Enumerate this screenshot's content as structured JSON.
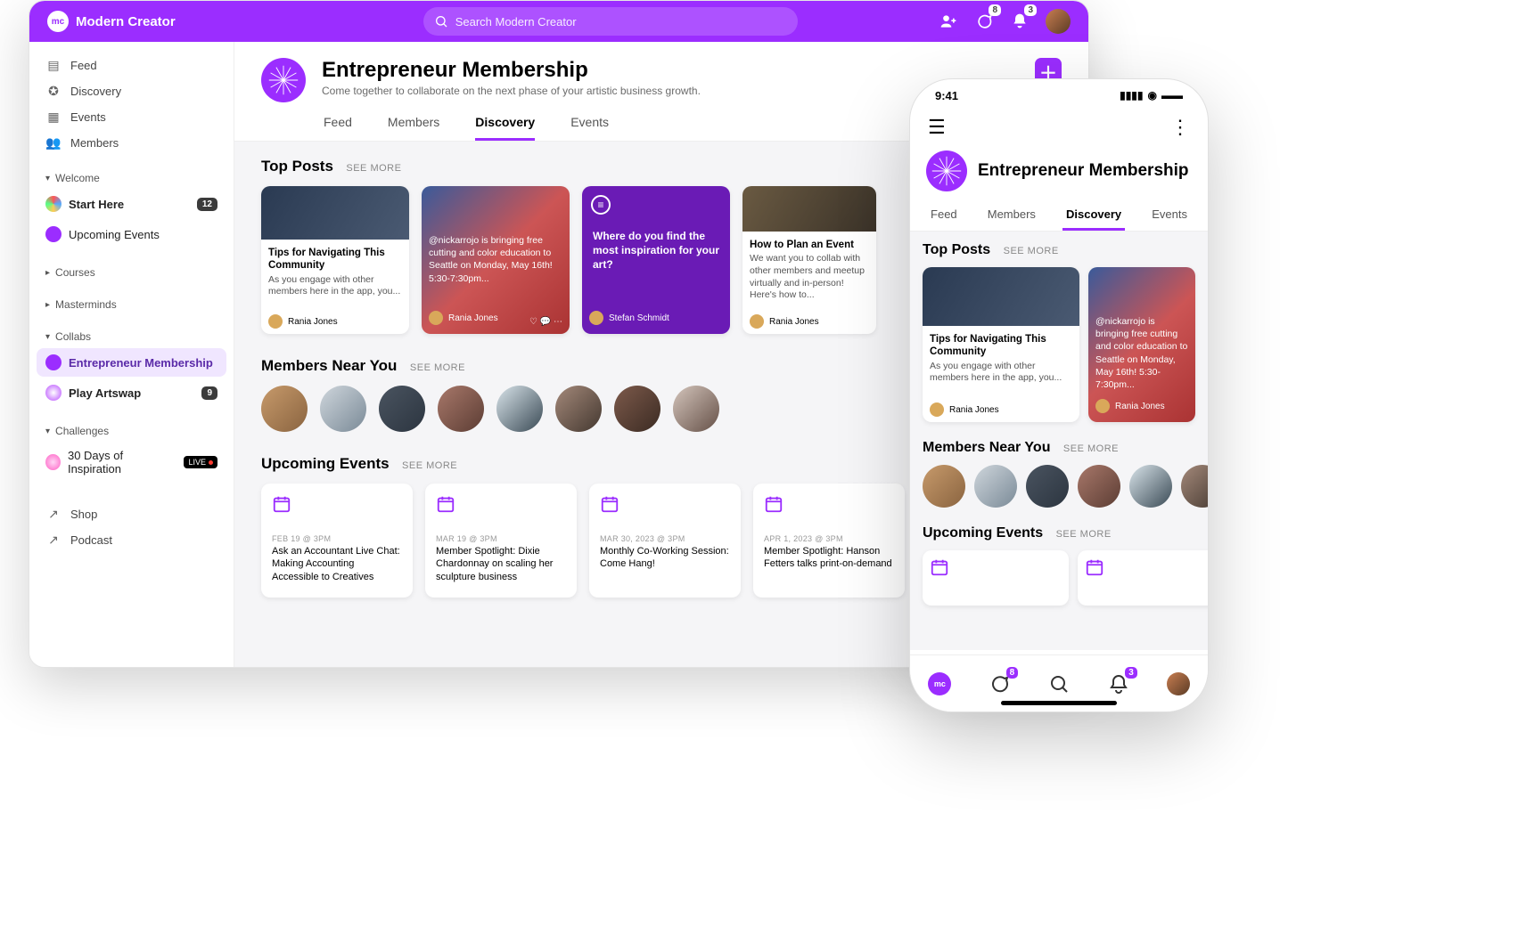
{
  "brand": "Modern Creator",
  "search_placeholder": "Search Modern Creator",
  "notif": {
    "chat": "8",
    "bell": "3"
  },
  "sidebar": {
    "primary": [
      {
        "icon": "▤",
        "label": "Feed"
      },
      {
        "icon": "➶",
        "label": "Discovery"
      },
      {
        "icon": "▦",
        "label": "Events"
      },
      {
        "icon": "👥",
        "label": "Members"
      }
    ],
    "welcome": {
      "header": "Welcome",
      "items": [
        {
          "label": "Start Here",
          "badge": "12"
        },
        {
          "label": "Upcoming Events"
        }
      ]
    },
    "courses": "Courses",
    "masterminds": "Masterminds",
    "collabs": {
      "header": "Collabs",
      "items": [
        {
          "label": "Entrepreneur Membership",
          "active": true
        },
        {
          "label": "Play Artswap",
          "badge": "9"
        }
      ]
    },
    "challenges": {
      "header": "Challenges",
      "items": [
        {
          "label": "30 Days of Inspiration",
          "live": "LIVE"
        }
      ]
    },
    "links": [
      {
        "icon": "↗",
        "label": "Shop"
      },
      {
        "icon": "↗",
        "label": "Podcast"
      }
    ]
  },
  "page": {
    "title": "Entrepreneur Membership",
    "subtitle": "Come together to collaborate on the next phase of your artistic business growth.",
    "tabs": [
      "Feed",
      "Members",
      "Discovery",
      "Events"
    ],
    "active_tab": "Discovery"
  },
  "sections": {
    "top_posts": {
      "title": "Top Posts",
      "see_more": "SEE MORE",
      "posts": [
        {
          "type": "std",
          "title": "Tips for Navigating This Community",
          "text": "As you engage with other members here in the app, you...",
          "author": "Rania Jones"
        },
        {
          "type": "imgfull",
          "text": "@nickarrojo is bringing free cutting and color education to Seattle on Monday, May 16th! 5:30-7:30pm...",
          "author": "Rania Jones"
        },
        {
          "type": "question",
          "text": "Where do you find the most inspiration for your art?",
          "author": "Stefan Schmidt"
        },
        {
          "type": "std",
          "title": "How to Plan an Event",
          "text": "We want you to collab with other members and meetup virtually and in-person! Here's how to...",
          "author": "Rania Jones"
        }
      ]
    },
    "members": {
      "title": "Members Near You",
      "see_more": "SEE MORE"
    },
    "events": {
      "title": "Upcoming Events",
      "see_more": "SEE MORE",
      "items": [
        {
          "date": "FEB 19 @ 3PM",
          "title": "Ask an Accountant Live Chat: Making Accounting Accessible to Creatives"
        },
        {
          "date": "MAR 19 @ 3PM",
          "title": "Member Spotlight: Dixie Chardonnay on scaling her sculpture business"
        },
        {
          "date": "MAR 30, 2023 @ 3PM",
          "title": "Monthly Co-Working Session: Come Hang!"
        },
        {
          "date": "APR 1, 2023 @ 3PM",
          "title": "Member Spotlight: Hanson Fetters talks print-on-demand"
        }
      ]
    }
  },
  "mobile": {
    "time": "9:41",
    "badge_chat": "8",
    "badge_bell": "3"
  }
}
